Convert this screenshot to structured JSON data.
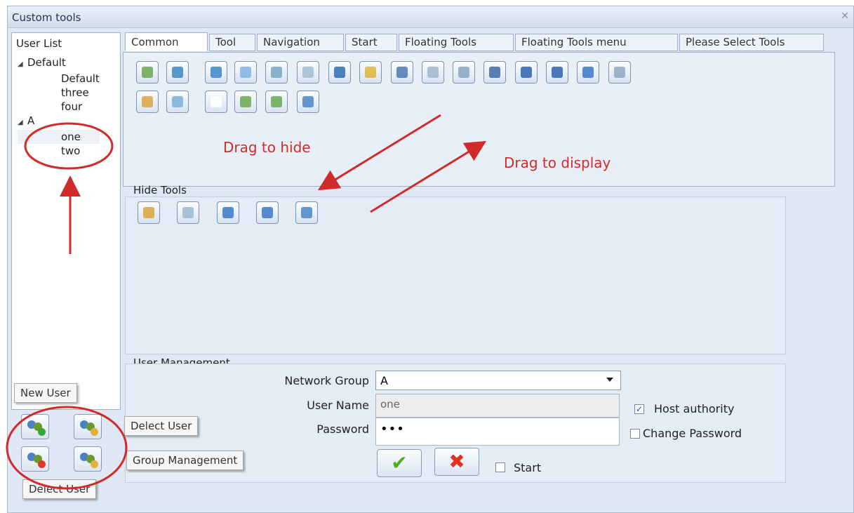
{
  "window": {
    "title": "Custom tools",
    "close_icon": "close-icon"
  },
  "user_list": {
    "header": "User List",
    "groups": [
      {
        "label": "Default",
        "children": [
          "Default",
          "three",
          "four"
        ]
      },
      {
        "label": "A",
        "children": [
          "one",
          "two"
        ]
      }
    ]
  },
  "tabs": [
    "Common",
    "Tool",
    "Navigation",
    "Start",
    "Floating Tools",
    "Floating Tools menu",
    "Please Select Tools"
  ],
  "active_tab": "Common",
  "common_tools": [
    "new-page-icon",
    "play-icon",
    "pen-icon",
    "smart-pen-icon",
    "brush-icon",
    "shape-pen-icon",
    "highlighter-icon",
    "marker-icon",
    "eraser-icon",
    "select-icon",
    "gesture-icon",
    "recognize-icon",
    "undo-icon",
    "redo-icon",
    "screen-icon",
    "capture-icon",
    "magnifier-icon",
    "shapes-icon",
    "blank-page-icon",
    "insert-icon",
    "replace-icon",
    "monitor-icon"
  ],
  "hide_tools": {
    "label": "Hide Tools",
    "tools": [
      "magnifier-icon",
      "spotlight-icon",
      "eraser-icon",
      "pen-icon",
      "panel-icon"
    ]
  },
  "annotations": {
    "drag_to_hide": "Drag to hide",
    "drag_to_display": "Drag to display"
  },
  "user_management": {
    "label": "User Management",
    "network_group_label": "Network Group",
    "network_group_value": "A",
    "user_name_label": "User Name",
    "user_name_value": "one",
    "password_label": "Password",
    "password_value": "•••",
    "host_authority_label": "Host authority",
    "host_authority_checked": true,
    "change_password_label": "Change Password",
    "change_password_checked": false,
    "start_label": "Start",
    "start_checked": false,
    "ok_icon": "check-icon",
    "cancel_icon": "x-icon"
  },
  "user_buttons": {
    "new_user_tip": "New User",
    "delete_user_tip_right": "Delect User",
    "group_management_tip": "Group Management",
    "delete_user_tip_bottom": "Delect User"
  },
  "colors": {
    "annotation_red": "#d12a2a",
    "panel_bg": "#e4ecf5",
    "title_text": "#1d3557"
  }
}
